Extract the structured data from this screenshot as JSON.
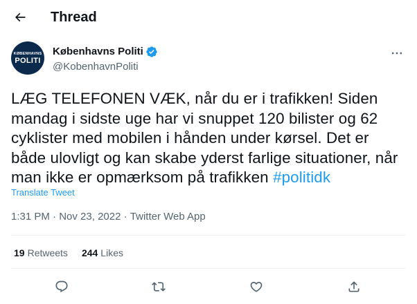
{
  "header": {
    "title": "Thread",
    "back_icon": "arrow-left-icon"
  },
  "author": {
    "avatar_top_text": "KØBENHAVNS",
    "avatar_main_text": "POLITI",
    "avatar_color": "#0c2a4c",
    "display_name": "Københavns Politi",
    "verified": true,
    "verified_color": "#1d9bf0",
    "handle": "@KobenhavnPoliti"
  },
  "tweet": {
    "body": "LÆG TELEFONEN VÆK, når du er i trafikken! Siden mandag i sidste uge har vi snuppet 120 bilister og 62 cyklister med mobilen i hånden under kørsel. Det er både ulovligt og kan skabe yderst farlige situationer, når man ikke er opmærksom på trafikken",
    "hashtag": "#politidk",
    "hashtag_color": "#1d9bf0",
    "translate_label": "Translate Tweet",
    "time": "1:31 PM",
    "separator": " · ",
    "date": "Nov 23, 2022",
    "source": "Twitter Web App"
  },
  "stats": {
    "retweets_count": "19",
    "retweets_label": "Retweets",
    "likes_count": "244",
    "likes_label": "Likes"
  },
  "actions": [
    "reply-icon",
    "retweet-icon",
    "like-icon",
    "share-icon"
  ]
}
